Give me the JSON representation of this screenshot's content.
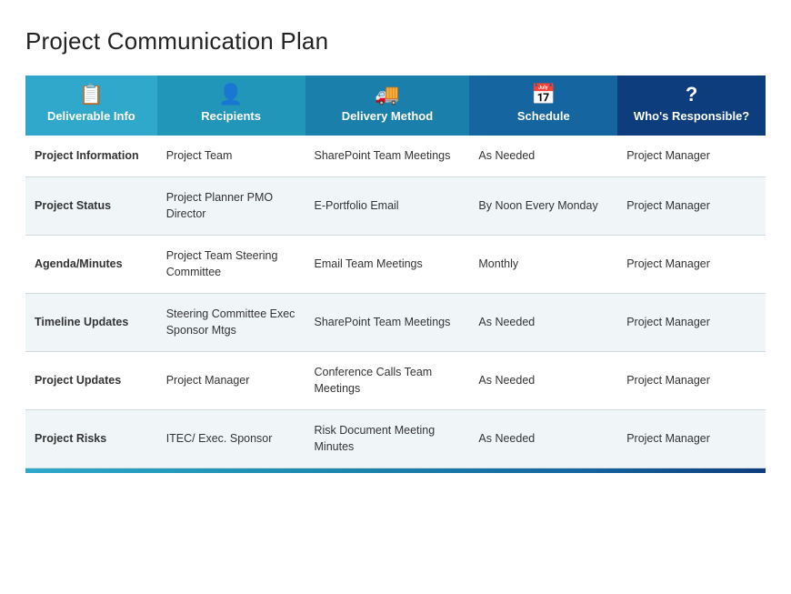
{
  "title": "Project Communication Plan",
  "table": {
    "headers": [
      {
        "key": "deliverable",
        "icon": "📋",
        "label": "Deliverable Info",
        "colorClass": "col-deliverable"
      },
      {
        "key": "recipients",
        "icon": "👤",
        "label": "Recipients",
        "colorClass": "col-recipients"
      },
      {
        "key": "delivery",
        "icon": "🚚",
        "label": "Delivery Method",
        "colorClass": "col-delivery"
      },
      {
        "key": "schedule",
        "icon": "📅",
        "label": "Schedule",
        "colorClass": "col-schedule"
      },
      {
        "key": "responsible",
        "icon": "?",
        "label": "Who's Responsible?",
        "colorClass": "col-responsible"
      }
    ],
    "rows": [
      {
        "deliverable": "Project Information",
        "recipients": "Project Team",
        "delivery": "SharePoint Team Meetings",
        "schedule": "As Needed",
        "responsible": "Project Manager"
      },
      {
        "deliverable": "Project Status",
        "recipients": "Project Planner PMO Director",
        "delivery": "E-Portfolio Email",
        "schedule": "By Noon Every Monday",
        "responsible": "Project Manager"
      },
      {
        "deliverable": "Agenda/Minutes",
        "recipients": "Project Team Steering Committee",
        "delivery": "Email Team Meetings",
        "schedule": "Monthly",
        "responsible": "Project Manager"
      },
      {
        "deliverable": "Timeline Updates",
        "recipients": "Steering Committee Exec Sponsor Mtgs",
        "delivery": "SharePoint Team Meetings",
        "schedule": "As Needed",
        "responsible": "Project Manager"
      },
      {
        "deliverable": "Project Updates",
        "recipients": "Project Manager",
        "delivery": "Conference Calls Team Meetings",
        "schedule": "As Needed",
        "responsible": "Project Manager"
      },
      {
        "deliverable": "Project Risks",
        "recipients": "ITEC/ Exec. Sponsor",
        "delivery": "Risk Document Meeting Minutes",
        "schedule": "As Needed",
        "responsible": "Project Manager"
      }
    ]
  }
}
